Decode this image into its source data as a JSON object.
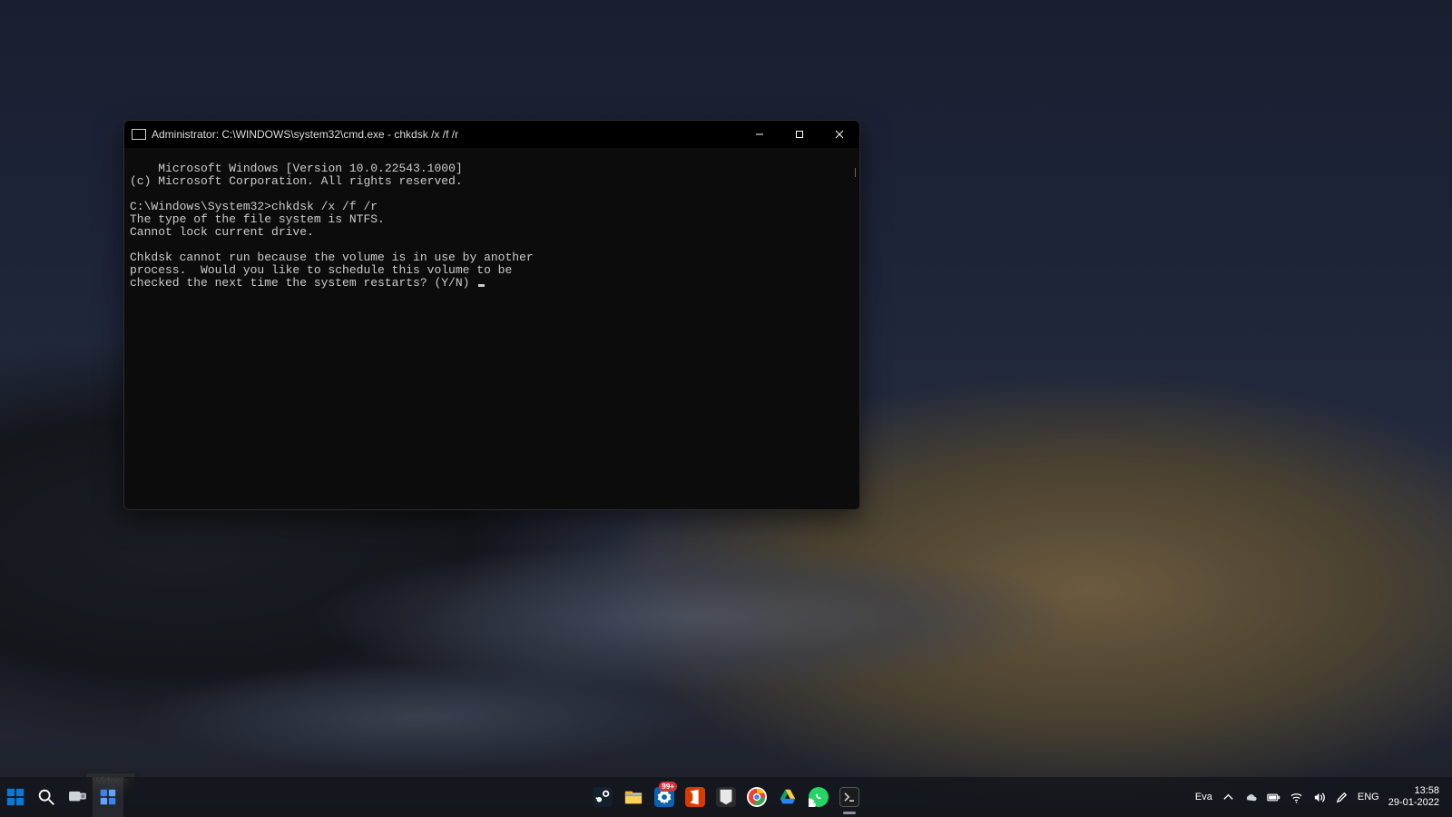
{
  "window": {
    "title": "Administrator: C:\\WINDOWS\\system32\\cmd.exe - chkdsk  /x /f /r"
  },
  "terminal": {
    "lines": [
      "Microsoft Windows [Version 10.0.22543.1000]",
      "(c) Microsoft Corporation. All rights reserved.",
      "",
      "C:\\Windows\\System32>chkdsk /x /f /r",
      "The type of the file system is NTFS.",
      "Cannot lock current drive.",
      "",
      "Chkdsk cannot run because the volume is in use by another",
      "process.  Would you like to schedule this volume to be",
      "checked the next time the system restarts? (Y/N) "
    ]
  },
  "tooltip": {
    "text": "Widgets"
  },
  "taskbar": {
    "left": [
      {
        "name": "start",
        "label": "Start"
      },
      {
        "name": "search",
        "label": "Search"
      },
      {
        "name": "taskview",
        "label": "Task View"
      },
      {
        "name": "widgets",
        "label": "Widgets"
      }
    ],
    "center": [
      {
        "name": "steam",
        "label": "Steam"
      },
      {
        "name": "file-explorer",
        "label": "File Explorer"
      },
      {
        "name": "settings",
        "label": "Settings",
        "badge": "99+"
      },
      {
        "name": "office",
        "label": "Office"
      },
      {
        "name": "epic",
        "label": "Epic Games"
      },
      {
        "name": "chrome",
        "label": "Chrome"
      },
      {
        "name": "drive",
        "label": "Google Drive"
      },
      {
        "name": "whatsapp",
        "label": "WhatsApp"
      },
      {
        "name": "cmd",
        "label": "Command Prompt",
        "active": true
      }
    ],
    "tray": {
      "user_hint": "Eva",
      "lang": "ENG",
      "time": "13:58",
      "date": "29-01-2022"
    }
  }
}
